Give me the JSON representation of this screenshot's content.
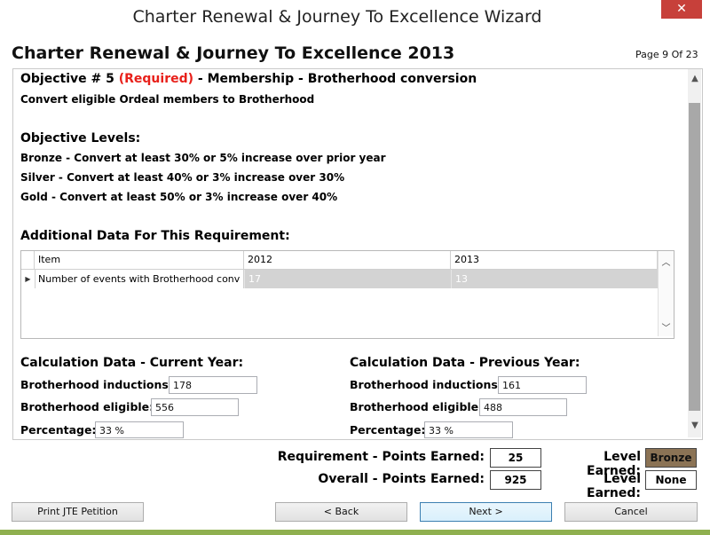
{
  "window": {
    "title": "Charter Renewal & Journey To Excellence Wizard",
    "close_glyph": "✕"
  },
  "header": {
    "title": "Charter Renewal & Journey To Excellence 2013",
    "page_indicator": "Page 9 Of 23"
  },
  "objective": {
    "prefix": "Objective # 5",
    "required": "(Required)",
    "suffix": "- Membership - Brotherhood conversion",
    "description": "Convert eligible Ordeal members to Brotherhood",
    "levels_heading": "Objective Levels:",
    "levels": [
      "Bronze - Convert at least 30% or 5% increase over prior year",
      "Silver - Convert at least 40% or 3% increase over 30%",
      "Gold - Convert at least 50% or 3% increase over 40%"
    ]
  },
  "additional_data": {
    "heading": "Additional Data For This Requirement:",
    "columns": [
      "Item",
      "2012",
      "2013"
    ],
    "rows": [
      {
        "item": "Number of events with Brotherhood conv",
        "y2012": "17",
        "y2013": "13"
      }
    ]
  },
  "current_year": {
    "heading": "Calculation Data - Current Year:",
    "inductions_label": "Brotherhood inductions:",
    "inductions_value": "178",
    "eligible_label": "Brotherhood eligible:",
    "eligible_value": "556",
    "percentage_label": "Percentage:",
    "percentage_value": "33 %"
  },
  "previous_year": {
    "heading": "Calculation Data - Previous Year:",
    "inductions_label": "Brotherhood inductions:",
    "inductions_value": "161",
    "eligible_label": "Brotherhood eligible:",
    "eligible_value": "488",
    "percentage_label": "Percentage:",
    "percentage_value": "33 %"
  },
  "summary": {
    "req_points_label": "Requirement - Points Earned:",
    "req_points_value": "25",
    "req_level_label": "Level Earned:",
    "req_level_value": "Bronze",
    "req_level_color": "#8b7355",
    "overall_points_label": "Overall - Points Earned:",
    "overall_points_value": "925",
    "overall_level_label": "Level Earned:",
    "overall_level_value": "None"
  },
  "buttons": {
    "print": "Print JTE Petition",
    "back": "< Back",
    "next": "Next >",
    "cancel": "Cancel"
  },
  "icons": {
    "scroll_up": "▲",
    "scroll_down": "▼",
    "row_indicator": "▶",
    "grid_up": "︿",
    "grid_down": "﹀"
  }
}
